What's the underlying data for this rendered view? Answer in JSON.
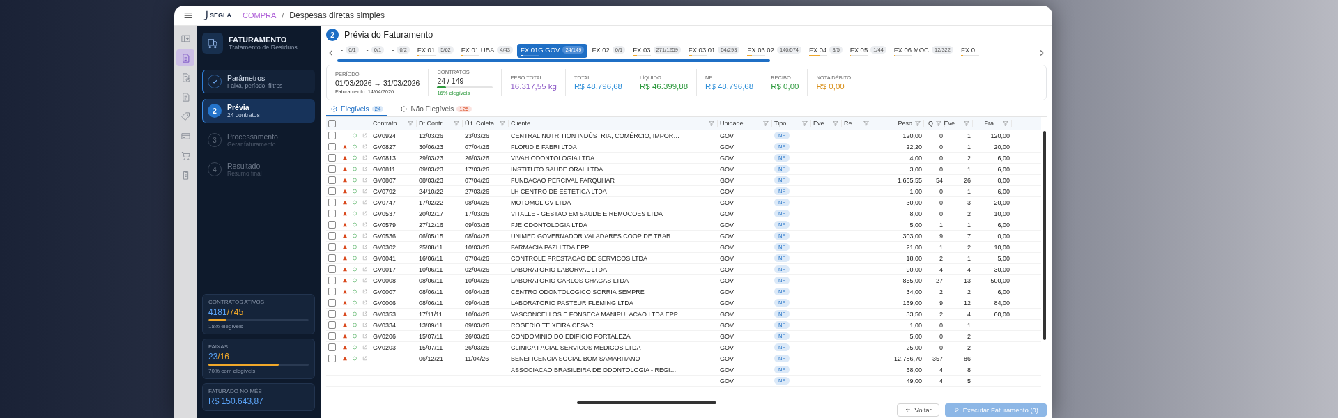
{
  "topbar": {
    "logo": "SEGLA",
    "breadcrumb": {
      "section": "COMPRA",
      "separator": "/",
      "page": "Despesas diretas simples"
    }
  },
  "rail": [
    {
      "selected": false
    },
    {
      "selected": true
    },
    {
      "selected": false
    },
    {
      "selected": false
    },
    {
      "selected": false
    },
    {
      "selected": false
    },
    {
      "selected": false
    },
    {
      "selected": false
    }
  ],
  "sidebar": {
    "title": "FATURAMENTO",
    "subtitle": "Tratamento de Resíduos",
    "steps": [
      {
        "title": "Parâmetros",
        "subtitle": "Faixa, período, filtros",
        "done": true,
        "selected": false
      },
      {
        "number": "2",
        "title": "Prévia",
        "subtitle": "24 contratos",
        "done": false,
        "selected": true
      },
      {
        "number": "3",
        "title": "Processamento",
        "subtitle": "Gerar faturamento",
        "done": false,
        "selected": false
      },
      {
        "number": "4",
        "title": "Resultado",
        "subtitle": "Resumo final",
        "done": false,
        "selected": false
      }
    ],
    "stats": [
      {
        "label": "CONTRATOS ATIVOS",
        "value_a": "4181",
        "value_b": "/745",
        "level": 0.18,
        "note": "18% elegíveis"
      },
      {
        "label": "FAIXAS",
        "value_a": "23",
        "value_b": "/16",
        "level": 0.7,
        "note": "70% com elegíveis"
      },
      {
        "label": "FATURADO NO MÊS",
        "value_a": "R$ 150.643,87"
      }
    ]
  },
  "page": {
    "step": "2",
    "title": "Prévia do Faturamento"
  },
  "fx_tabs": [
    {
      "label": "-",
      "count": "0/1",
      "selected": false
    },
    {
      "label": "-",
      "count": "0/1",
      "selected": false
    },
    {
      "label": "-",
      "count": "0/2",
      "selected": false
    },
    {
      "label": "FX 01",
      "count": "5/62",
      "level": 0.08,
      "selected": false
    },
    {
      "label": "FX 01 UBA",
      "count": "4/43",
      "level": 0.09,
      "selected": false
    },
    {
      "label": "FX 01G GOV",
      "count": "24/149",
      "level": 0.16,
      "selected": true
    },
    {
      "label": "FX 02",
      "count": "0/1",
      "selected": false
    },
    {
      "label": "FX 03",
      "count": "271/1259",
      "level": 0.22,
      "selected": false
    },
    {
      "label": "FX 03.01",
      "count": "54/293",
      "level": 0.18,
      "selected": false
    },
    {
      "label": "FX 03.02",
      "count": "140/574",
      "level": 0.24,
      "selected": false
    },
    {
      "label": "FX 04",
      "count": "3/5",
      "level": 0.6,
      "selected": false
    },
    {
      "label": "FX 05",
      "count": "1/44",
      "level": 0.02,
      "selected": false
    },
    {
      "label": "FX 06 MOC",
      "count": "12/322",
      "level": 0.04,
      "selected": false
    },
    {
      "label": "FX 0",
      "level": 0.1,
      "selected": false
    }
  ],
  "summary": {
    "period": {
      "label": "PERÍODO",
      "range": "01/03/2026 → 31/03/2026",
      "billing": "Faturamento: 14/04/2026"
    },
    "contracts": {
      "label": "CONTRATOS",
      "value": "24 / 149",
      "level": 0.16,
      "note": "16% elegíveis"
    },
    "amounts": [
      {
        "label": "PESO TOTAL",
        "value": "16.317,55 kg",
        "color": "#8e5bc7"
      },
      {
        "label": "TOTAL",
        "value": "R$ 48.796,68",
        "color": "#2f8fd8"
      },
      {
        "label": "LÍQUIDO",
        "value": "R$ 46.399,88",
        "color": "#2e9a3e"
      },
      {
        "label": "NF",
        "value": "R$ 48.796,68",
        "color": "#2f8fd8"
      },
      {
        "label": "RECIBO",
        "value": "R$ 0,00",
        "color": "#2e9a3e"
      },
      {
        "label": "NOTA DÉBITO",
        "value": "R$ 0,00",
        "color": "#d9901a"
      }
    ]
  },
  "table_tabs": [
    {
      "label": "Elegíveis",
      "count": "24",
      "selected": true
    },
    {
      "label": "Não Elegíveis",
      "count": "125",
      "selected": false
    }
  ],
  "table": {
    "header_checked": false,
    "columns": [
      "Contrato",
      "Dt Contr…",
      "Últ. Coleta",
      "Cliente",
      "Unidade",
      "Tipo",
      "Eve…",
      "Re…",
      "Peso",
      "Q",
      "Eve…",
      "Fra…"
    ],
    "rows": [
      {
        "checked": false,
        "warning": false,
        "contrato": "GV0924",
        "dt": "12/03/26",
        "ult": "23/03/26",
        "cliente": "CENTRAL NUTRITION INDÚSTRIA, COMÉRCIO, IMPOR…",
        "unidade": "GOV",
        "tipo": "NF",
        "peso": "120,00",
        "q": "0",
        "eve": "1",
        "fra": "120,00"
      },
      {
        "checked": false,
        "warning": true,
        "contrato": "GV0827",
        "dt": "30/06/23",
        "ult": "07/04/26",
        "cliente": "FLORID E FABRI LTDA",
        "unidade": "GOV",
        "tipo": "NF",
        "peso": "22,20",
        "q": "0",
        "eve": "1",
        "fra": "20,00"
      },
      {
        "checked": false,
        "warning": true,
        "contrato": "GV0813",
        "dt": "29/03/23",
        "ult": "26/03/26",
        "cliente": "VIVAH ODONTOLOGIA LTDA",
        "unidade": "GOV",
        "tipo": "NF",
        "peso": "4,00",
        "q": "0",
        "eve": "2",
        "fra": "6,00"
      },
      {
        "checked": false,
        "warning": true,
        "contrato": "GV0811",
        "dt": "09/03/23",
        "ult": "17/03/26",
        "cliente": "INSTITUTO SAUDE ORAL LTDA",
        "unidade": "GOV",
        "tipo": "NF",
        "peso": "3,00",
        "q": "0",
        "eve": "1",
        "fra": "6,00"
      },
      {
        "checked": false,
        "warning": true,
        "contrato": "GV0807",
        "dt": "08/03/23",
        "ult": "07/04/26",
        "cliente": "FUNDACAO PERCIVAL FARQUHAR",
        "unidade": "GOV",
        "tipo": "NF",
        "peso": "1.665,55",
        "q": "54",
        "eve": "26",
        "fra": "0,00"
      },
      {
        "checked": false,
        "warning": true,
        "contrato": "GV0792",
        "dt": "24/10/22",
        "ult": "27/03/26",
        "cliente": "LH CENTRO DE ESTETICA LTDA",
        "unidade": "GOV",
        "tipo": "NF",
        "peso": "1,00",
        "q": "0",
        "eve": "1",
        "fra": "6,00"
      },
      {
        "checked": false,
        "warning": true,
        "contrato": "GV0747",
        "dt": "17/02/22",
        "ult": "08/04/26",
        "cliente": "MOTOMOL GV LTDA",
        "unidade": "GOV",
        "tipo": "NF",
        "peso": "30,00",
        "q": "0",
        "eve": "3",
        "fra": "20,00"
      },
      {
        "checked": false,
        "warning": true,
        "contrato": "GV0537",
        "dt": "20/02/17",
        "ult": "17/03/26",
        "cliente": "VITALLE - GESTAO EM SAUDE E REMOCOES LTDA",
        "unidade": "GOV",
        "tipo": "NF",
        "peso": "8,00",
        "q": "0",
        "eve": "2",
        "fra": "10,00"
      },
      {
        "checked": false,
        "warning": true,
        "contrato": "GV0579",
        "dt": "27/12/16",
        "ult": "09/03/26",
        "cliente": "FJE ODONTOLOGIA LTDA",
        "unidade": "GOV",
        "tipo": "NF",
        "peso": "5,00",
        "q": "1",
        "eve": "1",
        "fra": "6,00"
      },
      {
        "checked": false,
        "warning": true,
        "contrato": "GV0536",
        "dt": "06/05/15",
        "ult": "08/04/26",
        "cliente": "UNIMED GOVERNADOR VALADARES COOP DE TRAB …",
        "unidade": "GOV",
        "tipo": "NF",
        "peso": "303,00",
        "q": "9",
        "eve": "7",
        "fra": "0,00"
      },
      {
        "checked": false,
        "warning": true,
        "contrato": "GV0302",
        "dt": "25/08/11",
        "ult": "10/03/26",
        "cliente": "FARMACIA PAZI LTDA EPP",
        "unidade": "GOV",
        "tipo": "NF",
        "peso": "21,00",
        "q": "1",
        "eve": "2",
        "fra": "10,00"
      },
      {
        "checked": false,
        "warning": true,
        "contrato": "GV0041",
        "dt": "16/06/11",
        "ult": "07/04/26",
        "cliente": "CONTROLE PRESTACAO DE SERVICOS LTDA",
        "unidade": "GOV",
        "tipo": "NF",
        "peso": "18,00",
        "q": "2",
        "eve": "1",
        "fra": "5,00"
      },
      {
        "checked": false,
        "warning": true,
        "contrato": "GV0017",
        "dt": "10/06/11",
        "ult": "02/04/26",
        "cliente": "LABORATORIO LABORVAL LTDA",
        "unidade": "GOV",
        "tipo": "NF",
        "peso": "90,00",
        "q": "4",
        "eve": "4",
        "fra": "30,00"
      },
      {
        "checked": false,
        "warning": true,
        "contrato": "GV0008",
        "dt": "08/06/11",
        "ult": "10/04/26",
        "cliente": "LABORATORIO CARLOS CHAGAS LTDA",
        "unidade": "GOV",
        "tipo": "NF",
        "peso": "855,00",
        "q": "27",
        "eve": "13",
        "fra": "500,00"
      },
      {
        "checked": false,
        "warning": true,
        "contrato": "GV0007",
        "dt": "08/06/11",
        "ult": "06/04/26",
        "cliente": "CENTRO ODONTOLOGICO SORRIA SEMPRE",
        "unidade": "GOV",
        "tipo": "NF",
        "peso": "34,00",
        "q": "2",
        "eve": "2",
        "fra": "6,00"
      },
      {
        "checked": false,
        "warning": true,
        "contrato": "GV0006",
        "dt": "08/06/11",
        "ult": "09/04/26",
        "cliente": "LABORATORIO PASTEUR FLEMING LTDA",
        "unidade": "GOV",
        "tipo": "NF",
        "peso": "169,00",
        "q": "9",
        "eve": "12",
        "fra": "84,00"
      },
      {
        "checked": false,
        "warning": true,
        "contrato": "GV0353",
        "dt": "17/11/11",
        "ult": "10/04/26",
        "cliente": "VASCONCELLOS E FONSECA MANIPULACAO LTDA EPP",
        "unidade": "GOV",
        "tipo": "NF",
        "peso": "33,50",
        "q": "2",
        "eve": "4",
        "fra": "60,00"
      },
      {
        "checked": false,
        "warning": true,
        "contrato": "GV0334",
        "dt": "13/09/11",
        "ult": "09/03/26",
        "cliente": "ROGERIO TEIXEIRA CESAR",
        "unidade": "GOV",
        "tipo": "NF",
        "peso": "1,00",
        "q": "0",
        "eve": "1"
      },
      {
        "checked": false,
        "warning": true,
        "contrato": "GV0206",
        "dt": "15/07/11",
        "ult": "26/03/26",
        "cliente": "CONDOMINIO DO EDIFICIO FORTALEZA",
        "unidade": "GOV",
        "tipo": "NF",
        "peso": "5,00",
        "q": "0",
        "eve": "2"
      },
      {
        "checked": false,
        "warning": true,
        "contrato": "GV0203",
        "dt": "15/07/11",
        "ult": "26/03/26",
        "cliente": "CLINICA FACIAL SERVICOS MEDICOS LTDA",
        "unidade": "GOV",
        "tipo": "NF",
        "peso": "25,00",
        "q": "0",
        "eve": "2"
      },
      {
        "checked": false,
        "warning": true,
        "dt": "06/12/21",
        "ult": "11/04/26",
        "cliente": "BENEFICENCIA SOCIAL BOM SAMARITANO",
        "unidade": "GOV",
        "tipo": "NF",
        "peso": "12.786,70",
        "q": "357",
        "eve": "86"
      },
      {
        "cliente": "ASSOCIACAO BRASILEIRA DE ODONTOLOGIA - REGI…",
        "unidade": "GOV",
        "tipo": "NF",
        "peso": "68,00",
        "q": "4",
        "eve": "8"
      },
      {
        "unidade": "GOV",
        "tipo": "NF",
        "peso": "49,00",
        "q": "4",
        "eve": "5"
      }
    ]
  },
  "footer": {
    "back": "Voltar",
    "run": "Executar Faturamento (0)"
  }
}
